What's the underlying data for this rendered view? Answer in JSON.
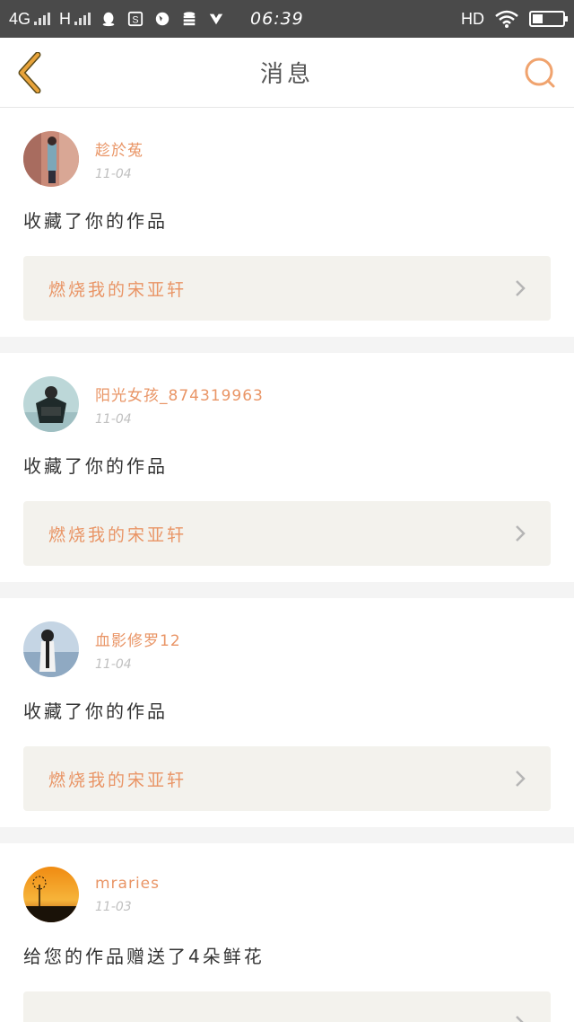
{
  "status": {
    "net1": "4G",
    "net2": "H",
    "time": "06:39",
    "hd": "HD",
    "battery_level": 0.35,
    "icons": [
      "qq-icon",
      "s-app-icon",
      "globe-icon",
      "database-icon",
      "vee-icon"
    ]
  },
  "nav": {
    "title": "消息"
  },
  "colors": {
    "accent": "#e99566",
    "back": "#e8a33a",
    "search": "#f0a36e",
    "card_bg": "#f3f2ed"
  },
  "notifications": [
    {
      "name": "趁於菟",
      "date": "11-04",
      "message": "收藏了你的作品",
      "work": "燃烧我的宋亚轩"
    },
    {
      "name": "阳光女孩_874319963",
      "date": "11-04",
      "message": "收藏了你的作品",
      "work": "燃烧我的宋亚轩"
    },
    {
      "name": "血影修罗12",
      "date": "11-04",
      "message": "收藏了你的作品",
      "work": "燃烧我的宋亚轩"
    },
    {
      "name": "mraries",
      "date": "11-03",
      "message": "给您的作品赠送了4朵鲜花",
      "work": ""
    }
  ]
}
